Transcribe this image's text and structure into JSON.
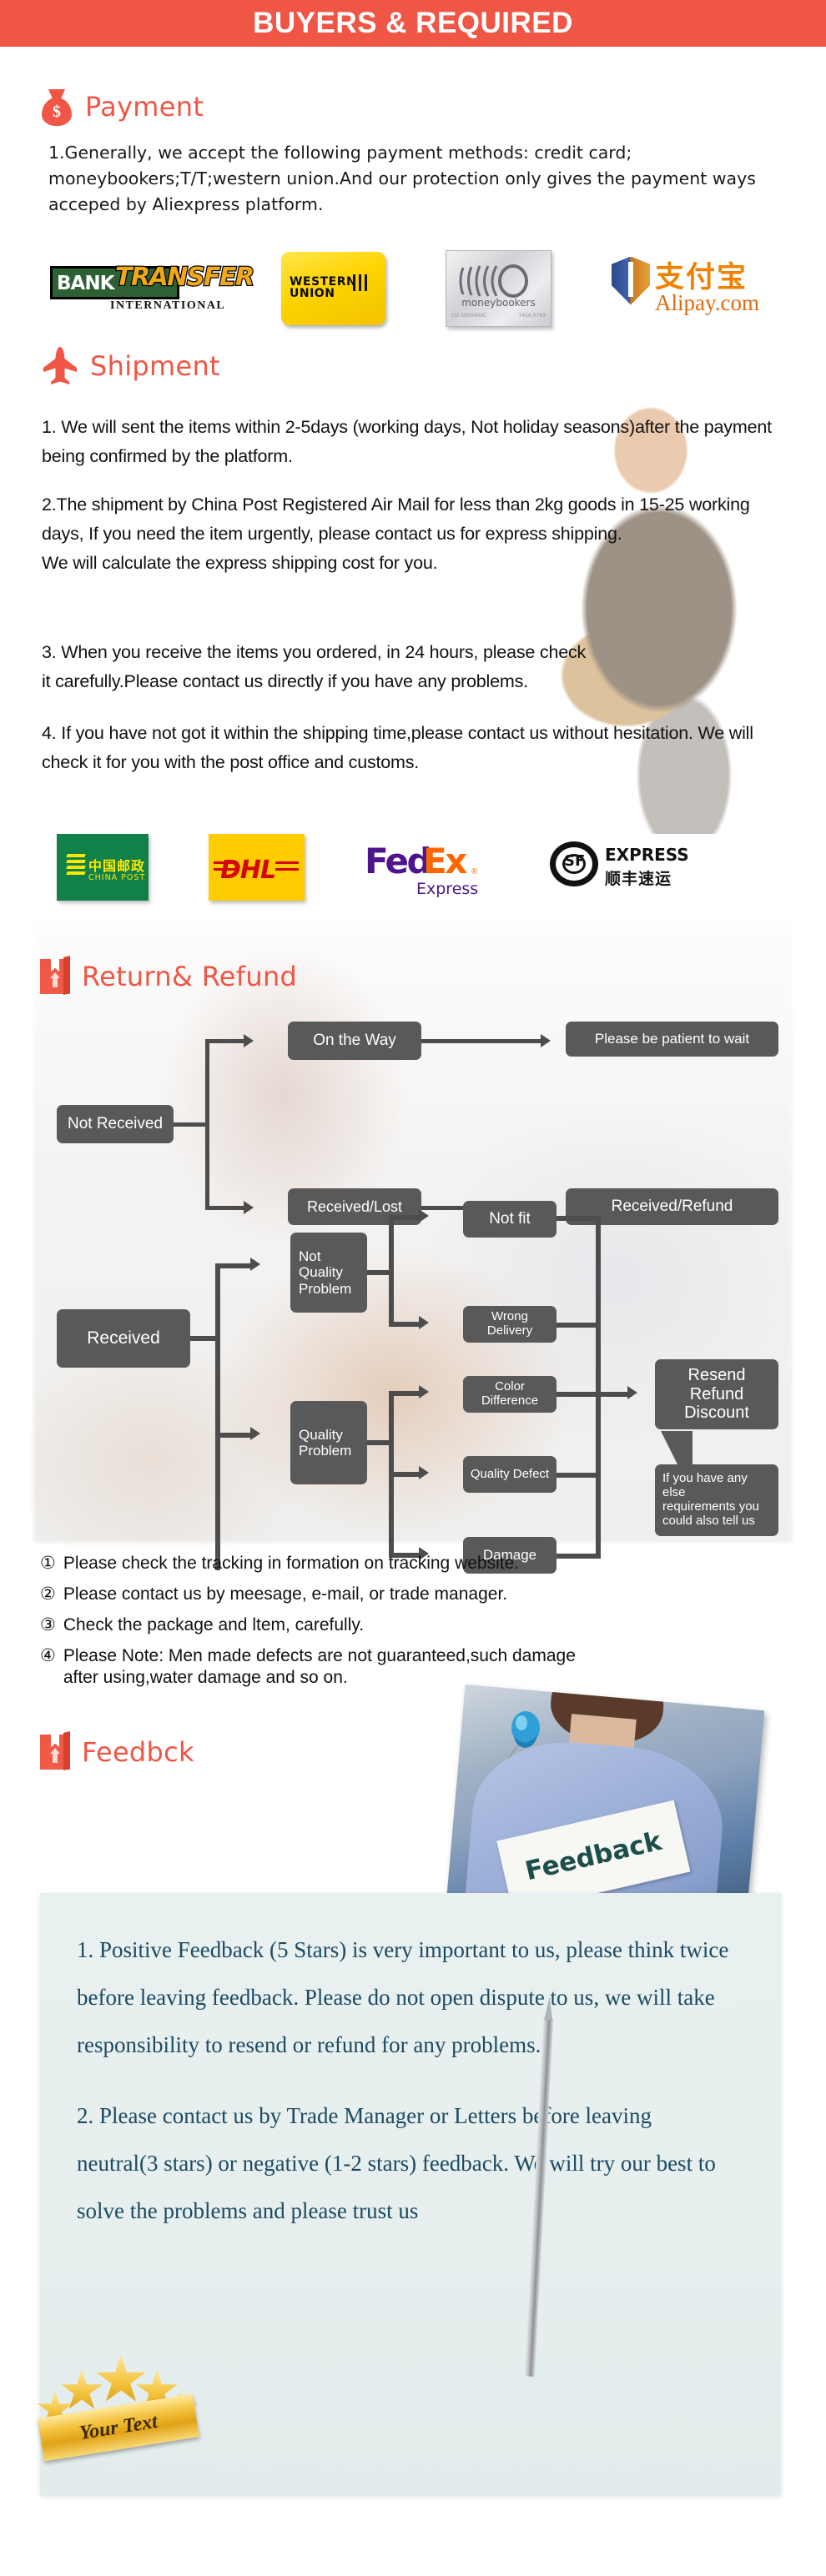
{
  "banner": {
    "title": "BUYERS & REQUIRED",
    "bg_color": "#ef5645",
    "text_color": "#ffffff"
  },
  "accent_color": "#ef5645",
  "sections": {
    "payment": {
      "heading": "Payment",
      "icon": "money-bag-icon",
      "body": "1.Generally, we accept the following payment methods: credit card; moneybookers;T/T;western union.And our protection only gives the payment ways acceped by Aliexpress platform.",
      "logos": [
        {
          "name": "bank-transfer-logo",
          "line1": "BANK",
          "line2": "TRANSFER",
          "line3": "INTERNATIONAL"
        },
        {
          "name": "western-union-logo",
          "line1": "WESTERN",
          "line2": "UNION"
        },
        {
          "name": "moneybookers-logo",
          "line1": "moneybookers",
          "micro_left": "CO-1000400C",
          "micro_right": "7416 0793"
        },
        {
          "name": "alipay-logo",
          "line1": "支付宝",
          "line2": "Alipay.com"
        }
      ]
    },
    "shipment": {
      "heading": "Shipment",
      "icon": "airplane-icon",
      "paragraphs": [
        "1. We will sent the items within 2-5days (working days, Not holiday seasons)after the payment being confirmed by the platform.",
        "2.The shipment by China Post Registered Air Mail for less than  2kg goods in 15-25 working days, If  you need the item urgently, please contact us for express shipping.\nWe will calculate the express shipping cost for you.",
        "3. When you receive the items you ordered, in 24 hours, please check\n it carefully.Please contact us directly if you have any problems.",
        "4. If you have not got it within the shipping time,please contact us without hesitation. We will check it for you with the post office and customs."
      ],
      "logos": [
        {
          "name": "china-post-logo",
          "zh": "中国邮政",
          "en": "CHINA POST"
        },
        {
          "name": "dhl-logo",
          "word": "DHL"
        },
        {
          "name": "fedex-logo",
          "fed": "Fed",
          "ex": "Ex",
          "reg": "®",
          "sub": "Express"
        },
        {
          "name": "sf-express-logo",
          "mark": "SF",
          "en": "EXPRESS",
          "zh": "顺丰速运"
        }
      ]
    },
    "return_refund": {
      "heading": "Return& Refund",
      "icon": "box-icon",
      "flow_not_received": {
        "root": "Not Received",
        "branches": [
          {
            "step": "On the Way",
            "result": "Please be patient to wait"
          },
          {
            "step": "Received/Lost",
            "result": "Received/Refund"
          }
        ]
      },
      "flow_received": {
        "root": "Received",
        "categories": [
          {
            "label": "Not\nQuality\nProblem",
            "items": [
              "Not fit",
              "Wrong Delivery"
            ]
          },
          {
            "label": "Quality\nProblem",
            "items": [
              "Color Difference",
              "Quality Defect",
              "Damage"
            ]
          }
        ],
        "result": "Resend\nRefund\nDiscount",
        "note": "If you have any else\nrequirements you\ncould also tell us"
      },
      "notes": [
        {
          "num": "①",
          "text": "Please check the tracking in formation on tracking website."
        },
        {
          "num": "②",
          "text": "Please contact us by meesage, e-mail, or trade manager."
        },
        {
          "num": "③",
          "text": "Check the package and ltem, carefully."
        },
        {
          "num": "④",
          "text": "Please Note: Men made defects  are not guaranteed,such damage\n  after using,water damage and so on."
        }
      ]
    },
    "feedback": {
      "heading": "Feedbck",
      "icon": "box-icon",
      "photo_sign_text": "Feedback",
      "paragraphs": [
        "1. Positive Feedback (5 Stars) is very important to us, please think twice before leaving feedback. Please do not open dispute to us,   we will take responsibility to resend or refund for any problems.",
        "2. Please contact us by Trade Manager or Letters before leaving neutral(3 stars) or negative (1-2 stars) feedback. We will try our best to solve the problems and please trust us"
      ],
      "badge_text": "Your Text",
      "box_color": "#e6efee",
      "text_color": "#1c4a63"
    }
  }
}
